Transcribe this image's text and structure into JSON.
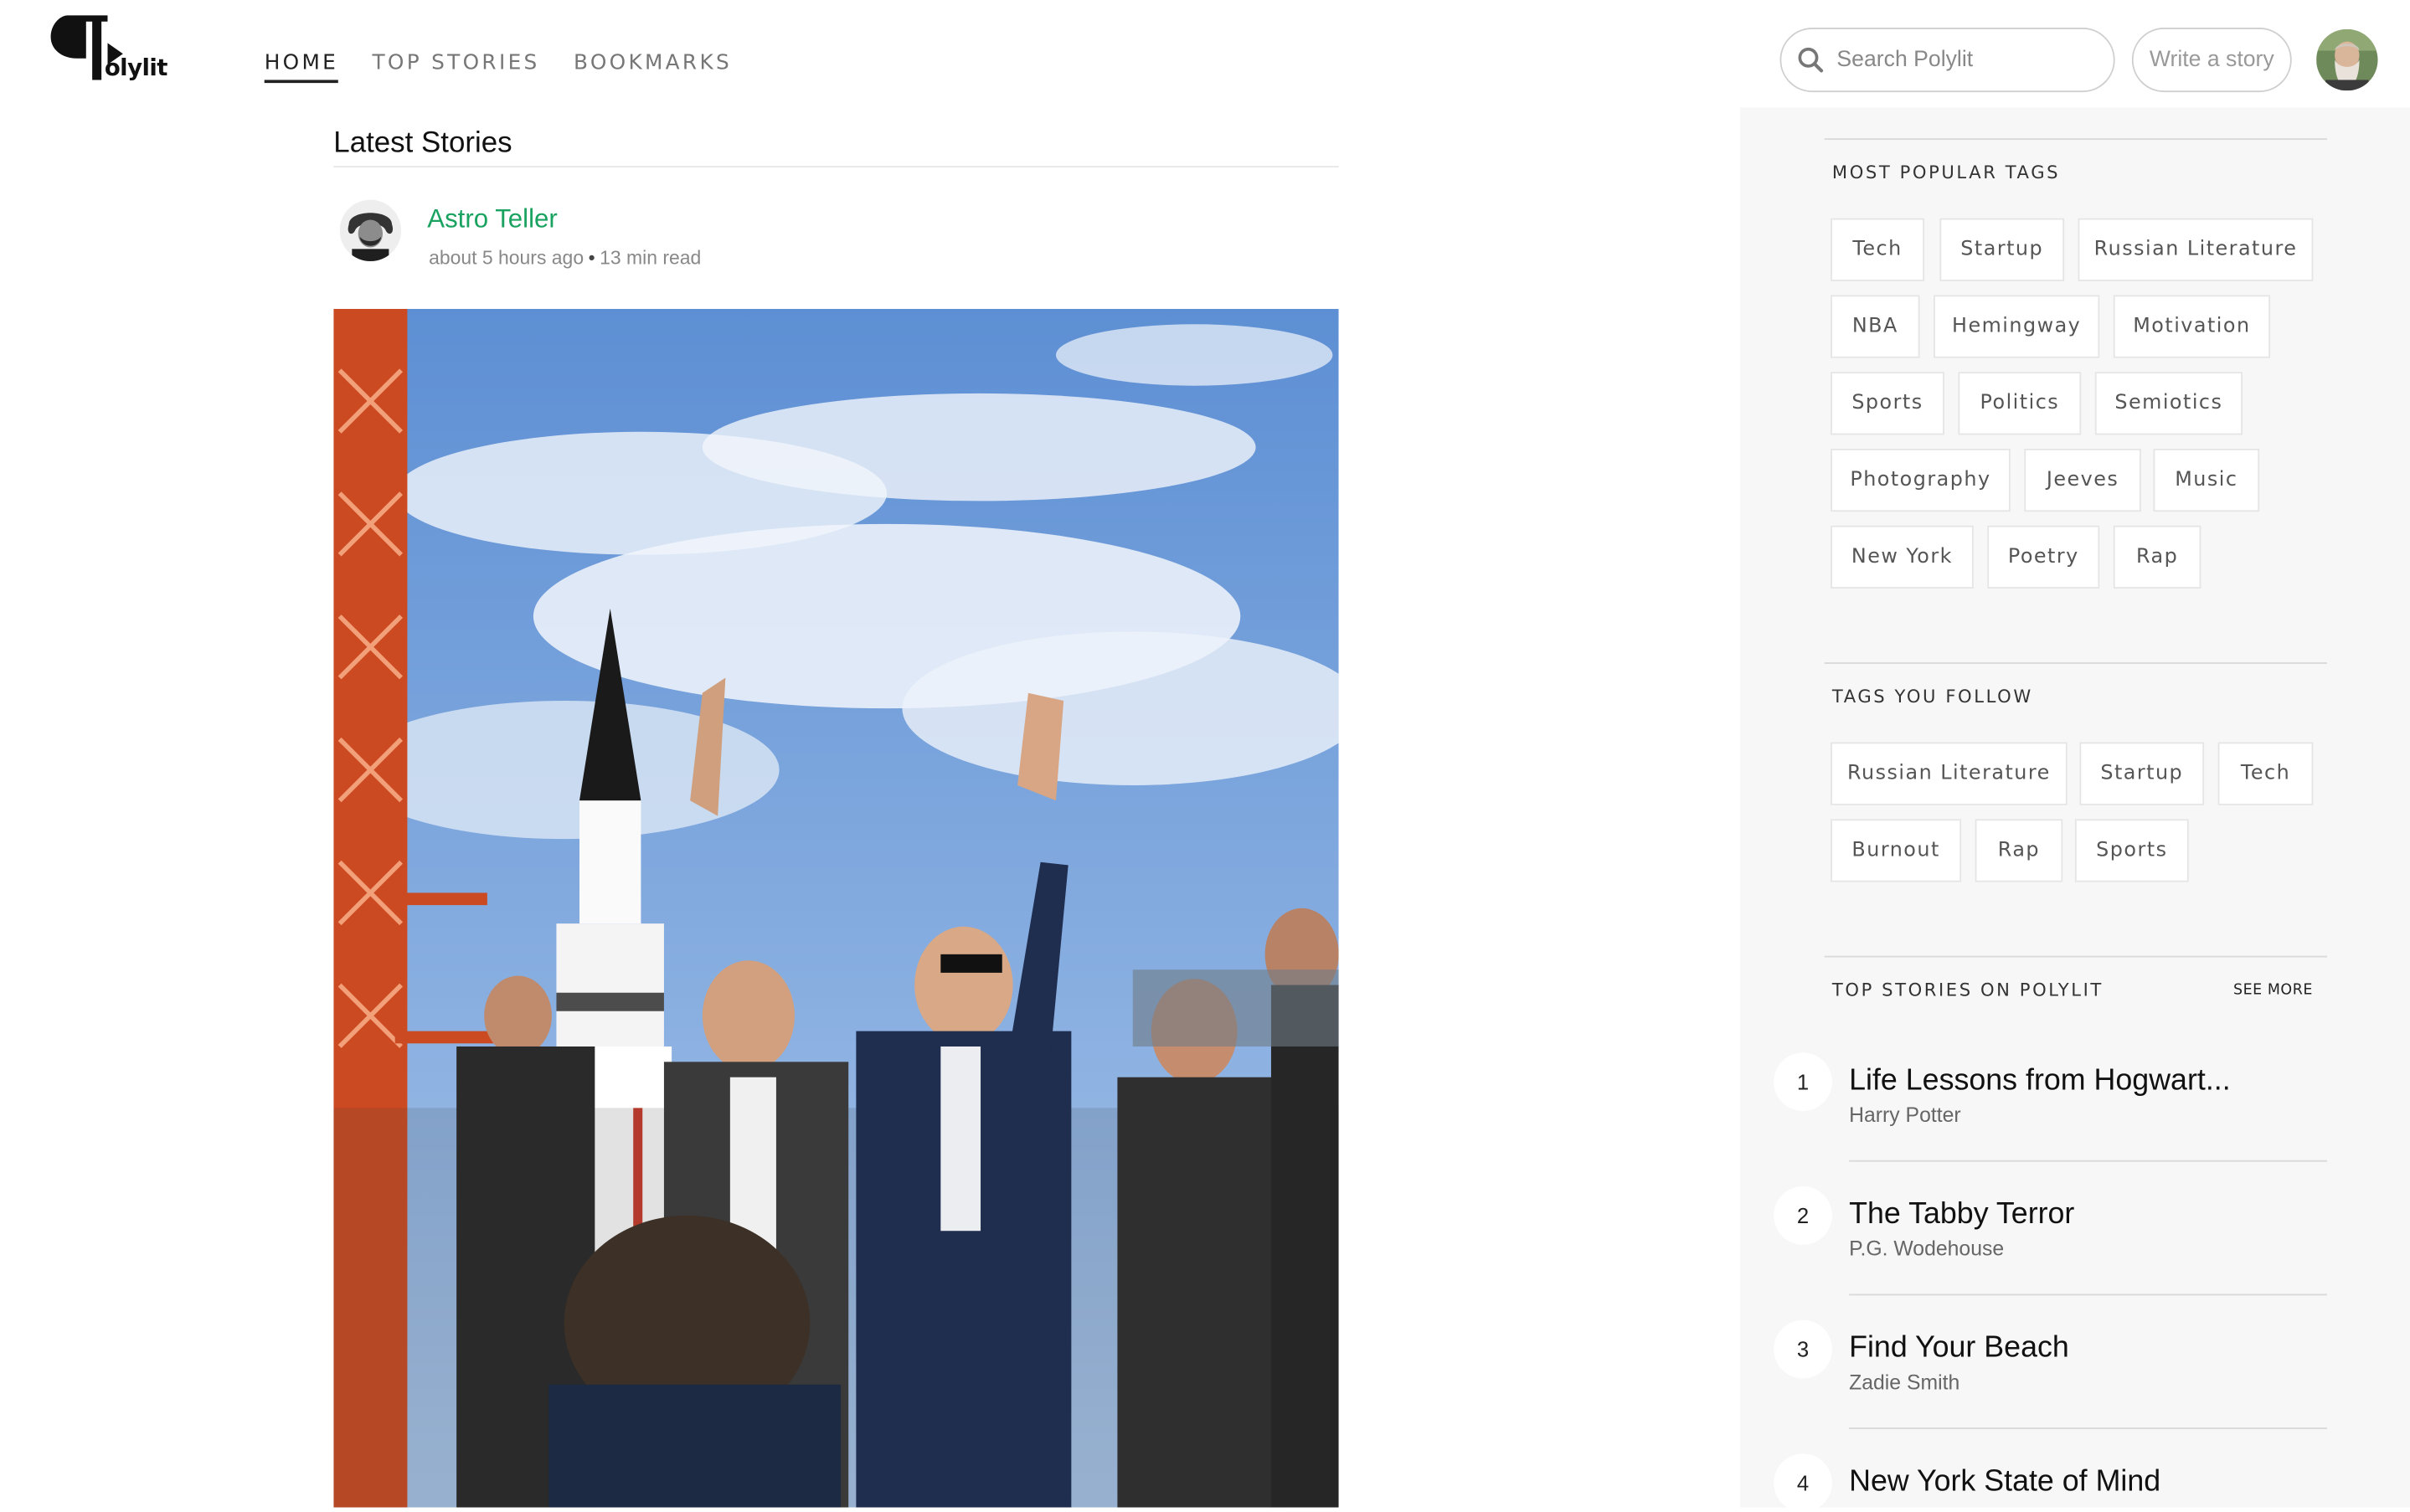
{
  "brand": {
    "logo_text": "olylit"
  },
  "nav": {
    "items": [
      {
        "label": "HOME"
      },
      {
        "label": "TOP STORIES"
      },
      {
        "label": "BOOKMARKS"
      }
    ]
  },
  "search": {
    "placeholder": "Search Polylit"
  },
  "header": {
    "write_label": "Write a story"
  },
  "main": {
    "section_title": "Latest Stories",
    "story": {
      "author": "Astro Teller",
      "time": "about 5 hours ago",
      "read_time": "13 min read"
    }
  },
  "sidebar": {
    "popular_tags": {
      "title": "MOST POPULAR TAGS",
      "tags": [
        "Tech",
        "Startup",
        "Russian Literature",
        "NBA",
        "Hemingway",
        "Motivation",
        "Sports",
        "Politics",
        "Semiotics",
        "Photography",
        "Jeeves",
        "Music",
        "New York",
        "Poetry",
        "Rap"
      ]
    },
    "followed_tags": {
      "title": "TAGS YOU FOLLOW",
      "tags": [
        "Russian Literature",
        "Startup",
        "Tech",
        "Burnout",
        "Rap",
        "Sports"
      ]
    },
    "top_stories": {
      "title": "TOP STORIES ON POLYLIT",
      "see_more": "SEE MORE",
      "items": [
        {
          "rank": "1",
          "title": "Life Lessons from Hogwart...",
          "author": "Harry Potter"
        },
        {
          "rank": "2",
          "title": "The Tabby Terror",
          "author": "P.G. Wodehouse"
        },
        {
          "rank": "3",
          "title": "Find Your Beach",
          "author": "Zadie Smith"
        },
        {
          "rank": "4",
          "title": "New York State of Mind",
          "author": ""
        }
      ]
    }
  },
  "colors": {
    "accent": "#1aa260",
    "sidebar_bg": "#f7f7f7"
  }
}
